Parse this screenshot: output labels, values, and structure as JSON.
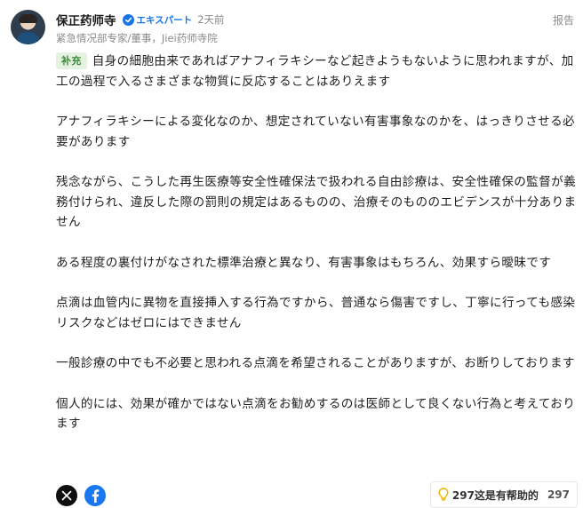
{
  "author": {
    "name": "保正药师寺",
    "badge": "エキスパート",
    "time": "2天前",
    "affiliation": "紧急情况部专家/董事，Jiei药师寺院"
  },
  "report_label": "报告",
  "content": {
    "supplement_tag": "补充",
    "paragraphs": [
      "自身の細胞由来であればアナフィラキシーなど起きようもないように思われますが、加工の過程で入るさまざまな物質に反応することはありえます",
      "アナフィラキシーによる変化なのか、想定されていない有害事象なのかを、はっきりさせる必要があります",
      "残念ながら、こうした再生医療等安全性確保法で扱われる自由診療は、安全性確保の監督が義務付けられ、違反した際の罰則の規定はあるものの、治療そのもののエビデンスが十分ありません",
      "ある程度の裏付けがなされた標準治療と異なり、有害事象はもちろん、効果すら曖昧です",
      "点滴は血管内に異物を直接挿入する行為ですから、普通なら傷害ですし、丁寧に行っても感染リスクなどはゼロにはできません",
      "一般診療の中でも不必要と思われる点滴を希望されることがありますが、お断りしております",
      "個人的には、効果が確かではない点滴をお勧めするのは医師として良くない行為と考えております"
    ]
  },
  "helpful": {
    "label": "297这是有帮助的",
    "count": "297"
  },
  "icons": {
    "share_x": "x-logo-icon",
    "share_facebook": "facebook-logo-icon",
    "helpful": "lightbulb-icon",
    "badge": "check-badge-icon"
  },
  "colors": {
    "badge_blue": "#1a73e8",
    "supplement_green_bg": "#e4f2df",
    "supplement_green_text": "#3c8a3a",
    "facebook_blue": "#1877f2",
    "bulb_yellow": "#f4b400"
  }
}
